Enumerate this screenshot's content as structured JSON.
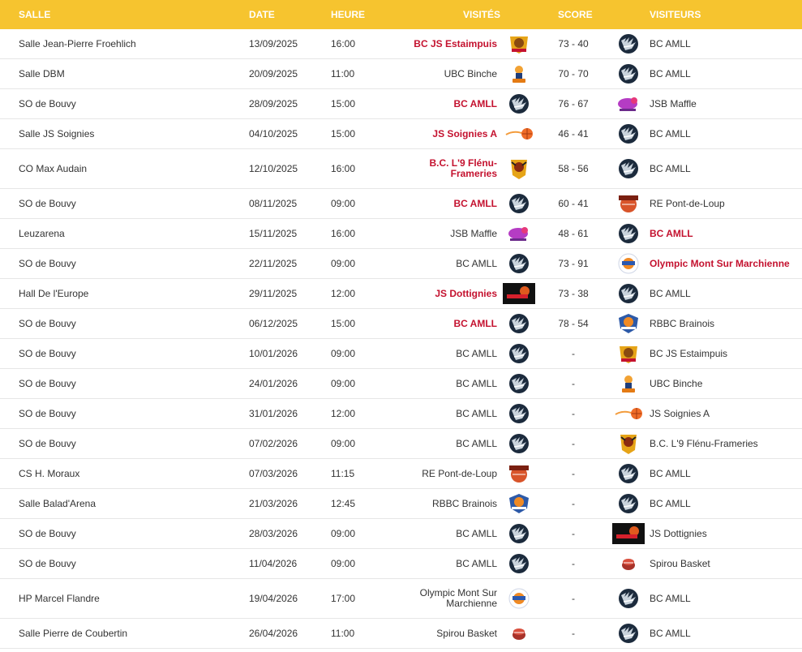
{
  "header": {
    "salle": "SALLE",
    "date": "DATE",
    "heure": "HEURE",
    "visites": "VISITÉS",
    "score": "SCORE",
    "visiteurs": "VISITEURS"
  },
  "colors": {
    "header_bg": "#f6c42f",
    "winner": "#c4122f",
    "text": "#333333"
  },
  "matches": [
    {
      "salle": "Salle Jean-Pierre Froehlich",
      "date": "13/09/2025",
      "heure": "16:00",
      "home": "BC JS Estaimpuis",
      "home_logo": "estaimpuis-logo",
      "home_win": true,
      "score": "73 - 40",
      "away": "BC AMLL",
      "away_logo": "amll-logo",
      "away_win": false
    },
    {
      "salle": "Salle DBM",
      "date": "20/09/2025",
      "heure": "11:00",
      "home": "UBC Binche",
      "home_logo": "binche-logo",
      "home_win": false,
      "score": "70 - 70",
      "away": "BC AMLL",
      "away_logo": "amll-logo",
      "away_win": false
    },
    {
      "salle": "SO de Bouvy",
      "date": "28/09/2025",
      "heure": "15:00",
      "home": "BC AMLL",
      "home_logo": "amll-logo",
      "home_win": true,
      "score": "76 - 67",
      "away": "JSB Maffle",
      "away_logo": "maffle-logo",
      "away_win": false
    },
    {
      "salle": "Salle JS Soignies",
      "date": "04/10/2025",
      "heure": "15:00",
      "home": "JS Soignies A",
      "home_logo": "soignies-logo",
      "home_win": true,
      "score": "46 - 41",
      "away": "BC AMLL",
      "away_logo": "amll-logo",
      "away_win": false
    },
    {
      "salle": "CO Max Audain",
      "date": "12/10/2025",
      "heure": "16:00",
      "home": "B.C. L'9 Flénu-Frameries",
      "home_logo": "flenu-logo",
      "home_win": true,
      "score": "58 - 56",
      "away": "BC AMLL",
      "away_logo": "amll-logo",
      "away_win": false
    },
    {
      "salle": "SO de Bouvy",
      "date": "08/11/2025",
      "heure": "09:00",
      "home": "BC AMLL",
      "home_logo": "amll-logo",
      "home_win": true,
      "score": "60 - 41",
      "away": "RE Pont-de-Loup",
      "away_logo": "pontdeloup-logo",
      "away_win": false
    },
    {
      "salle": "Leuzarena",
      "date": "15/11/2025",
      "heure": "16:00",
      "home": "JSB Maffle",
      "home_logo": "maffle-logo",
      "home_win": false,
      "score": "48 - 61",
      "away": "BC AMLL",
      "away_logo": "amll-logo",
      "away_win": true
    },
    {
      "salle": "SO de Bouvy",
      "date": "22/11/2025",
      "heure": "09:00",
      "home": "BC AMLL",
      "home_logo": "amll-logo",
      "home_win": false,
      "score": "73 - 91",
      "away": "Olympic Mont Sur Marchienne",
      "away_logo": "olympic-logo",
      "away_win": true
    },
    {
      "salle": "Hall De l'Europe",
      "date": "29/11/2025",
      "heure": "12:00",
      "home": "JS Dottignies",
      "home_logo": "dottignies-logo",
      "home_win": true,
      "score": "73 - 38",
      "away": "BC AMLL",
      "away_logo": "amll-logo",
      "away_win": false
    },
    {
      "salle": "SO de Bouvy",
      "date": "06/12/2025",
      "heure": "15:00",
      "home": "BC AMLL",
      "home_logo": "amll-logo",
      "home_win": true,
      "score": "78 - 54",
      "away": "RBBC Brainois",
      "away_logo": "brainois-logo",
      "away_win": false
    },
    {
      "salle": "SO de Bouvy",
      "date": "10/01/2026",
      "heure": "09:00",
      "home": "BC AMLL",
      "home_logo": "amll-logo",
      "home_win": false,
      "score": "-",
      "away": "BC JS Estaimpuis",
      "away_logo": "estaimpuis-logo",
      "away_win": false
    },
    {
      "salle": "SO de Bouvy",
      "date": "24/01/2026",
      "heure": "09:00",
      "home": "BC AMLL",
      "home_logo": "amll-logo",
      "home_win": false,
      "score": "-",
      "away": "UBC Binche",
      "away_logo": "binche-logo",
      "away_win": false
    },
    {
      "salle": "SO de Bouvy",
      "date": "31/01/2026",
      "heure": "12:00",
      "home": "BC AMLL",
      "home_logo": "amll-logo",
      "home_win": false,
      "score": "-",
      "away": "JS Soignies A",
      "away_logo": "soignies-logo",
      "away_win": false
    },
    {
      "salle": "SO de Bouvy",
      "date": "07/02/2026",
      "heure": "09:00",
      "home": "BC AMLL",
      "home_logo": "amll-logo",
      "home_win": false,
      "score": "-",
      "away": "B.C. L'9 Flénu-Frameries",
      "away_logo": "flenu-logo",
      "away_win": false
    },
    {
      "salle": "CS H. Moraux",
      "date": "07/03/2026",
      "heure": "11:15",
      "home": "RE Pont-de-Loup",
      "home_logo": "pontdeloup-logo",
      "home_win": false,
      "score": "-",
      "away": "BC AMLL",
      "away_logo": "amll-logo",
      "away_win": false
    },
    {
      "salle": "Salle Balad'Arena",
      "date": "21/03/2026",
      "heure": "12:45",
      "home": "RBBC Brainois",
      "home_logo": "brainois-logo",
      "home_win": false,
      "score": "-",
      "away": "BC AMLL",
      "away_logo": "amll-logo",
      "away_win": false
    },
    {
      "salle": "SO de Bouvy",
      "date": "28/03/2026",
      "heure": "09:00",
      "home": "BC AMLL",
      "home_logo": "amll-logo",
      "home_win": false,
      "score": "-",
      "away": "JS Dottignies",
      "away_logo": "dottignies-logo",
      "away_win": false
    },
    {
      "salle": "SO de Bouvy",
      "date": "11/04/2026",
      "heure": "09:00",
      "home": "BC AMLL",
      "home_logo": "amll-logo",
      "home_win": false,
      "score": "-",
      "away": "Spirou Basket",
      "away_logo": "spirou-logo",
      "away_win": false
    },
    {
      "salle": "HP Marcel Flandre",
      "date": "19/04/2026",
      "heure": "17:00",
      "home": "Olympic Mont Sur Marchienne",
      "home_logo": "olympic-logo",
      "home_win": false,
      "score": "-",
      "away": "BC AMLL",
      "away_logo": "amll-logo",
      "away_win": false
    },
    {
      "salle": "Salle Pierre de Coubertin",
      "date": "26/04/2026",
      "heure": "11:00",
      "home": "Spirou Basket",
      "home_logo": "spirou-logo",
      "home_win": false,
      "score": "-",
      "away": "BC AMLL",
      "away_logo": "amll-logo",
      "away_win": false
    }
  ]
}
